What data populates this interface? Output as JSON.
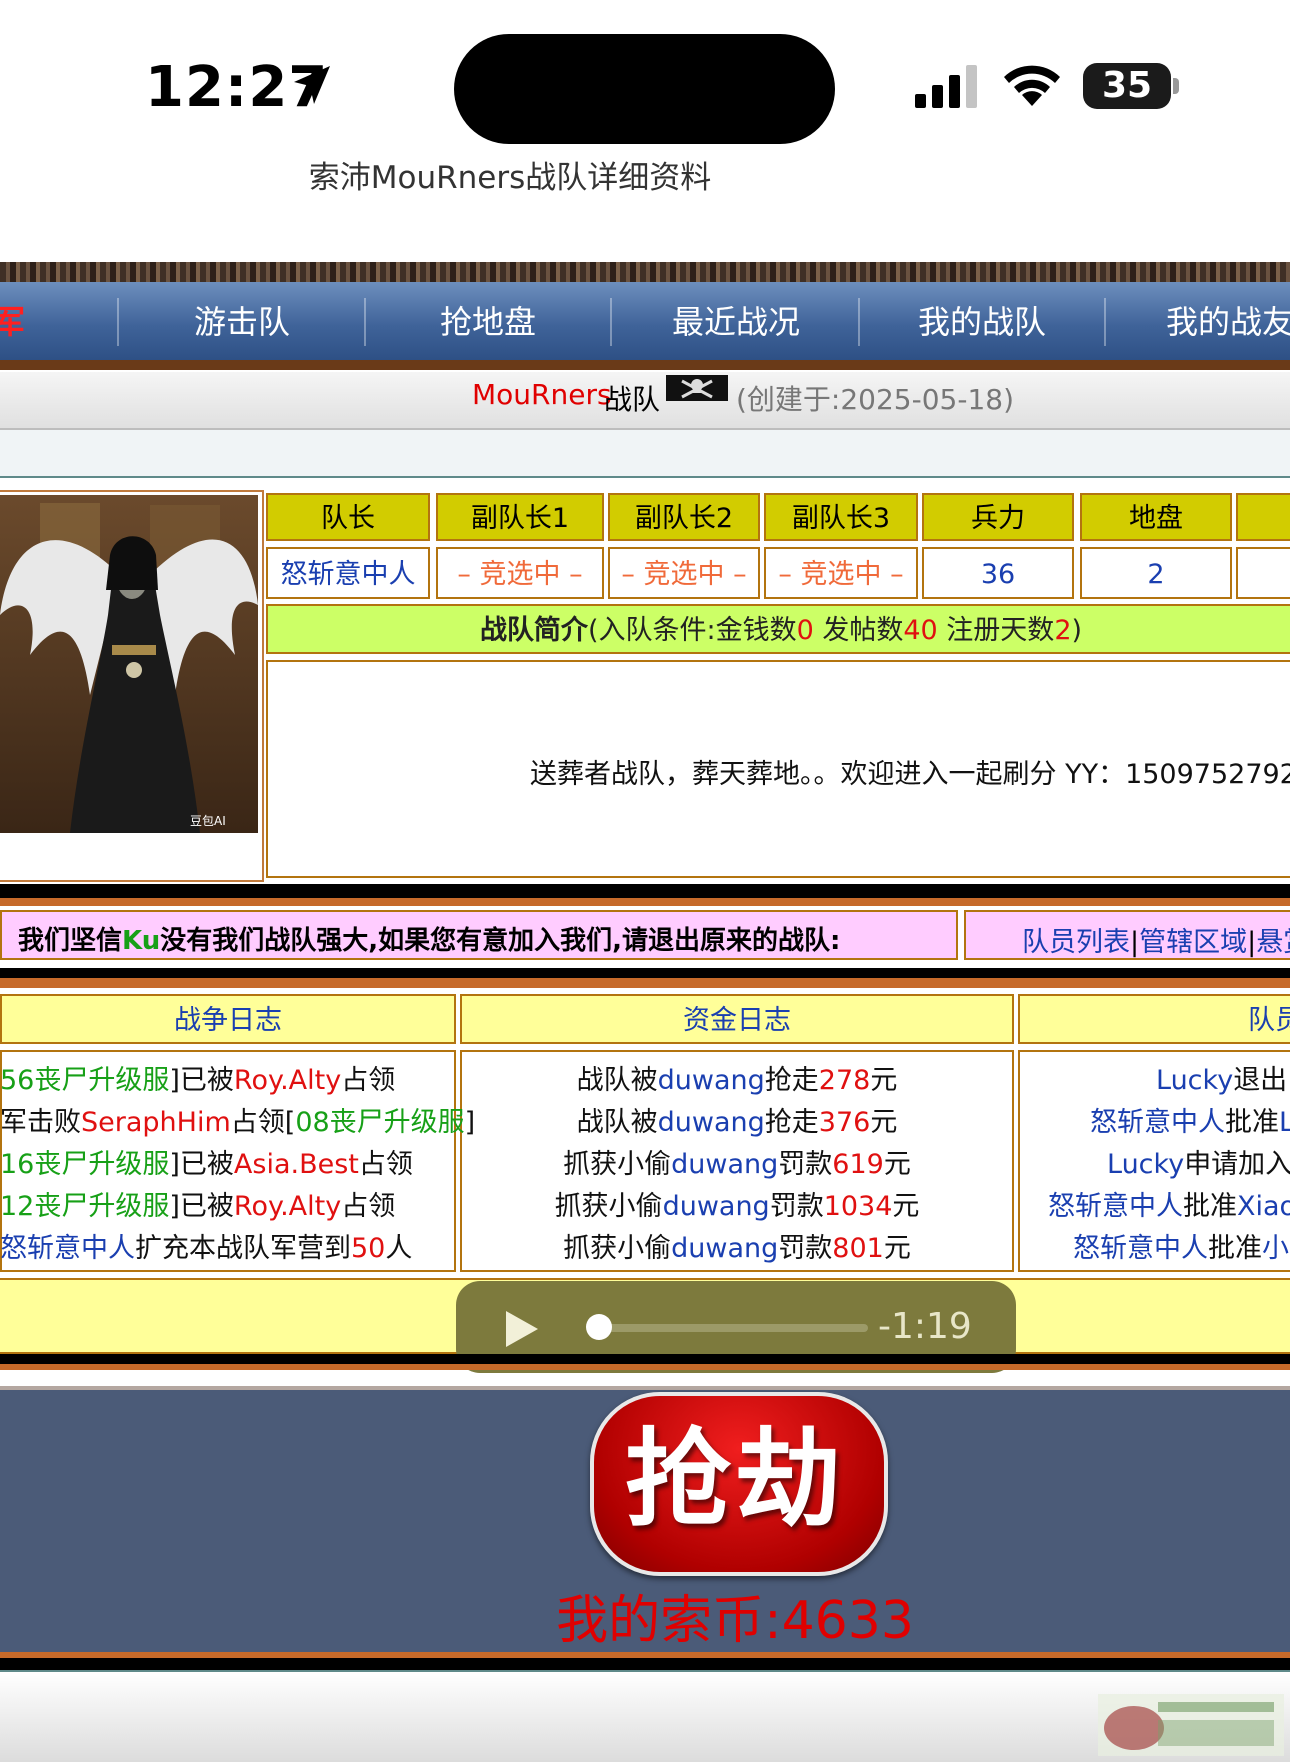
{
  "status_bar": {
    "time": "12:27",
    "battery": "35"
  },
  "page_title": "索沛MouRners战队详细资料",
  "nav": {
    "items": [
      "冠军",
      "游击队",
      "抢地盘",
      "最近战况",
      "我的战队",
      "我的战友"
    ]
  },
  "team": {
    "name": "MouRners",
    "word": "战队",
    "created": "(创建于:2025-05-18)"
  },
  "info_table": {
    "headers": [
      "队长",
      "副队长1",
      "副队长2",
      "副队长3",
      "兵力",
      "地盘",
      "..."
    ],
    "values": [
      "怒斩意中人",
      "– 竞选中 –",
      "– 竞选中 –",
      "– 竞选中 –",
      "36",
      "2",
      ""
    ]
  },
  "intro": {
    "label": "战队简介",
    "cond_prefix": "(入队条件:金钱数",
    "money": "0",
    "posts_label": " 发帖数",
    "posts": "40",
    "days_label": " 注册天数",
    "days": "2",
    "cond_suffix": ")",
    "text": "送葬者战队，葬天葬地。。欢迎进入一起刷分 YY：1509752792"
  },
  "recruit": {
    "prefix": "我们坚信",
    "ku": "Ku",
    "suffix": "没有我们战队强大,如果您有意加入我们,请退出原来的战队:",
    "links": [
      "队员列表",
      "管辖区域",
      "悬赏"
    ],
    "sep": "|"
  },
  "war_log": {
    "title": "战争日志",
    "lines": [
      {
        "a": "56丧尸升级服",
        "b": "]已被",
        "c": "Roy.Alty",
        "d": "占领"
      },
      {
        "a": "军击败",
        "b": "SeraphHim",
        "c": "占领[",
        "d": "08丧尸升级服",
        "e": "]"
      },
      {
        "a": "16丧尸升级服",
        "b": "]已被",
        "c": "Asia.Best",
        "d": "占领"
      },
      {
        "a": "12丧尸升级服",
        "b": "]已被",
        "c": "Roy.Alty",
        "d": "占领"
      },
      {
        "a": "怒斩意中人",
        "b": "扩充本战队军营到",
        "c": "50",
        "d": "人"
      }
    ]
  },
  "fund_log": {
    "title": "资金日志",
    "lines": [
      {
        "a": "战队被",
        "b": "duwang",
        "c": "抢走",
        "d": "278",
        "e": "元"
      },
      {
        "a": "战队被",
        "b": "duwang",
        "c": "抢走",
        "d": "376",
        "e": "元"
      },
      {
        "a": "抓获小偷",
        "b": "duwang",
        "c": "罚款",
        "d": "619",
        "e": "元"
      },
      {
        "a": "抓获小偷",
        "b": "duwang",
        "c": "罚款",
        "d": "1034",
        "e": "元"
      },
      {
        "a": "抓获小偷",
        "b": "duwang",
        "c": "罚款",
        "d": "801",
        "e": "元"
      }
    ]
  },
  "member_log": {
    "title": "队员",
    "lines": [
      {
        "a": "Lucky",
        "b": "退出"
      },
      {
        "a": "怒斩意中人",
        "b": "批准",
        "c": "L"
      },
      {
        "a": "Lucky",
        "b": "申请加入"
      },
      {
        "a": "怒斩意中人",
        "b": "批准",
        "c": "Xiao"
      },
      {
        "a": "怒斩意中人",
        "b": "批准",
        "c": "小"
      }
    ]
  },
  "audio": {
    "time_remaining": "-1:19",
    "progress": 0.0
  },
  "rob": {
    "label": "抢劫",
    "coins": "我的索币:4633"
  },
  "colors": {
    "nav": "#3f6399",
    "header_cell": "#d2cc00",
    "intro": "#ccff66",
    "recruit": "#ffccff",
    "log_head": "#ffff99",
    "rob_bg": "#4b5b78",
    "rob_button": "#d40000"
  }
}
